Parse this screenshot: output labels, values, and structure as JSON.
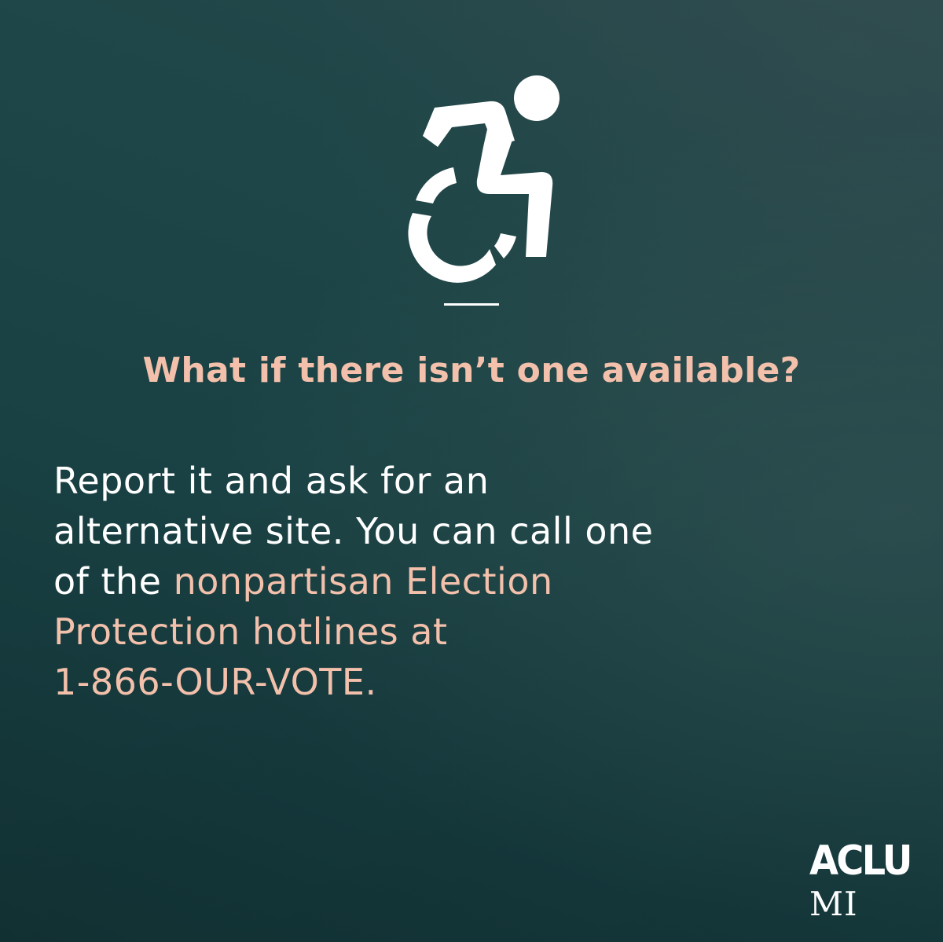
{
  "icon": "accessible-wheelchair-icon",
  "colors": {
    "accent": "#f2c0ab",
    "text": "#ffffff",
    "background": "#1c4345"
  },
  "heading": "What if there isn’t one available?",
  "body": {
    "line1": "Report it and ask for an",
    "line2": "alternative site. You can call one",
    "line3_prefix": "of the ",
    "line3_highlight": "nonpartisan Election",
    "line4_highlight": "Protection hotlines at",
    "line5_highlight": "1-866-OUR-VOTE."
  },
  "logo": {
    "name": "ACLU",
    "affiliate": "MI"
  }
}
